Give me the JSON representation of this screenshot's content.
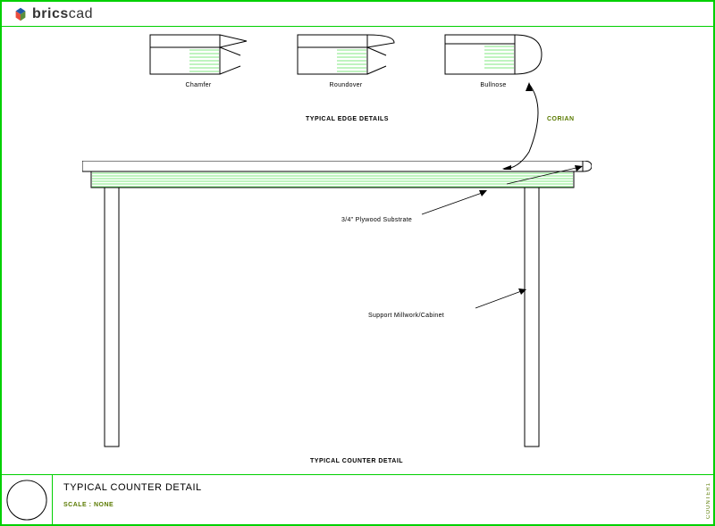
{
  "header": {
    "logo_brand": "brics",
    "logo_suffix": "cad"
  },
  "edge_profiles": {
    "section_title": "TYPICAL EDGE DETAILS",
    "profiles": [
      {
        "name": "Chamfer"
      },
      {
        "name": "Roundover"
      },
      {
        "name": "Bullnose"
      }
    ]
  },
  "annotations": {
    "corian": "CORIAN",
    "plywood": "3/4\" Plywood Substrate",
    "support": "Support Millwork/Cabinet"
  },
  "counter": {
    "section_title": "TYPICAL COUNTER DETAIL"
  },
  "title_block": {
    "title": "TYPICAL COUNTER DETAIL",
    "scale": "SCALE : NONE"
  },
  "side_label": "COUNTER1"
}
